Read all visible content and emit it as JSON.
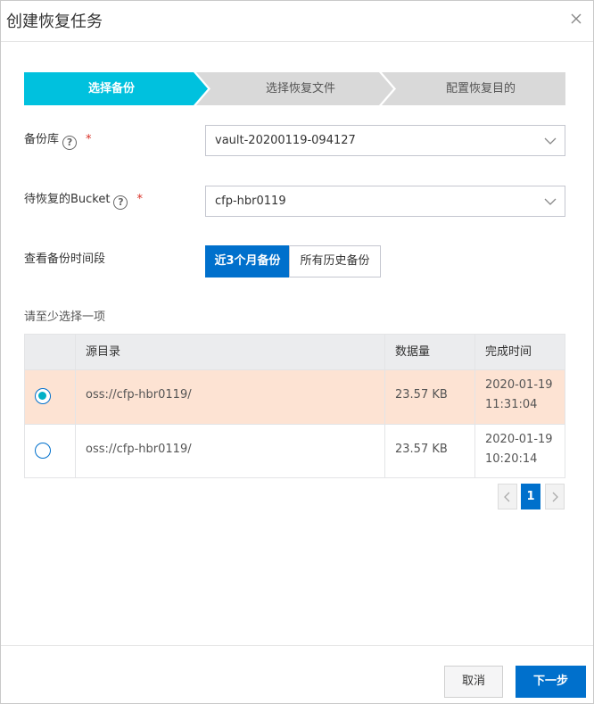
{
  "dialog": {
    "title": "创建恢复任务",
    "close_icon": "close-icon"
  },
  "steps": [
    {
      "label": "选择备份",
      "active": true
    },
    {
      "label": "选择恢复文件",
      "active": false
    },
    {
      "label": "配置恢复目的",
      "active": false
    }
  ],
  "form": {
    "vault": {
      "label": "备份库",
      "help": "?",
      "required": "*",
      "value": "vault-20200119-094127"
    },
    "bucket": {
      "label": "待恢复的Bucket",
      "help": "?",
      "required": "*",
      "value": "cfp-hbr0119"
    },
    "period": {
      "label": "查看备份时间段",
      "options": [
        "近3个月备份",
        "所有历史备份"
      ],
      "selected": "近3个月备份"
    }
  },
  "hint": "请至少选择一项",
  "table": {
    "columns": [
      "源目录",
      "数据量",
      "完成时间"
    ],
    "rows": [
      {
        "selected": true,
        "source": "oss://cfp-hbr0119/",
        "size": "23.57 KB",
        "date": "2020-01-19",
        "time": "11:31:04"
      },
      {
        "selected": false,
        "source": "oss://cfp-hbr0119/",
        "size": "23.57 KB",
        "date": "2020-01-19",
        "time": "10:20:14"
      }
    ]
  },
  "pagination": {
    "current": "1"
  },
  "footer": {
    "cancel_label": "取消",
    "next_label": "下一步"
  },
  "colors": {
    "accent": "#0070cc",
    "step_active": "#00c1de",
    "step_inactive": "#d9d9d9",
    "row_selected": "#fde3d3"
  }
}
